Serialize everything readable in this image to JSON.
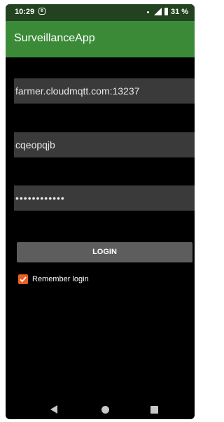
{
  "status_bar": {
    "time": "10:29",
    "notification_icon": "app-notification-icon",
    "battery": "31 %"
  },
  "app_bar": {
    "title": "SurveillanceApp"
  },
  "form": {
    "host_value": "farmer.cloudmqtt.com:13237",
    "username_value": "cqeopqjb",
    "password_value": "••••••••••••",
    "login_label": "LOGIN",
    "remember_label": "Remember login",
    "remember_checked": true
  },
  "nav_bar": {
    "back_icon": "back-icon",
    "home_icon": "home-icon",
    "recents_icon": "recents-icon"
  },
  "colors": {
    "status_bar": "#23421f",
    "app_bar": "#3b8a38",
    "field_bg": "#3a3a3a",
    "button_bg": "#5d5d5d",
    "checkbox_accent": "#ec5d23"
  }
}
